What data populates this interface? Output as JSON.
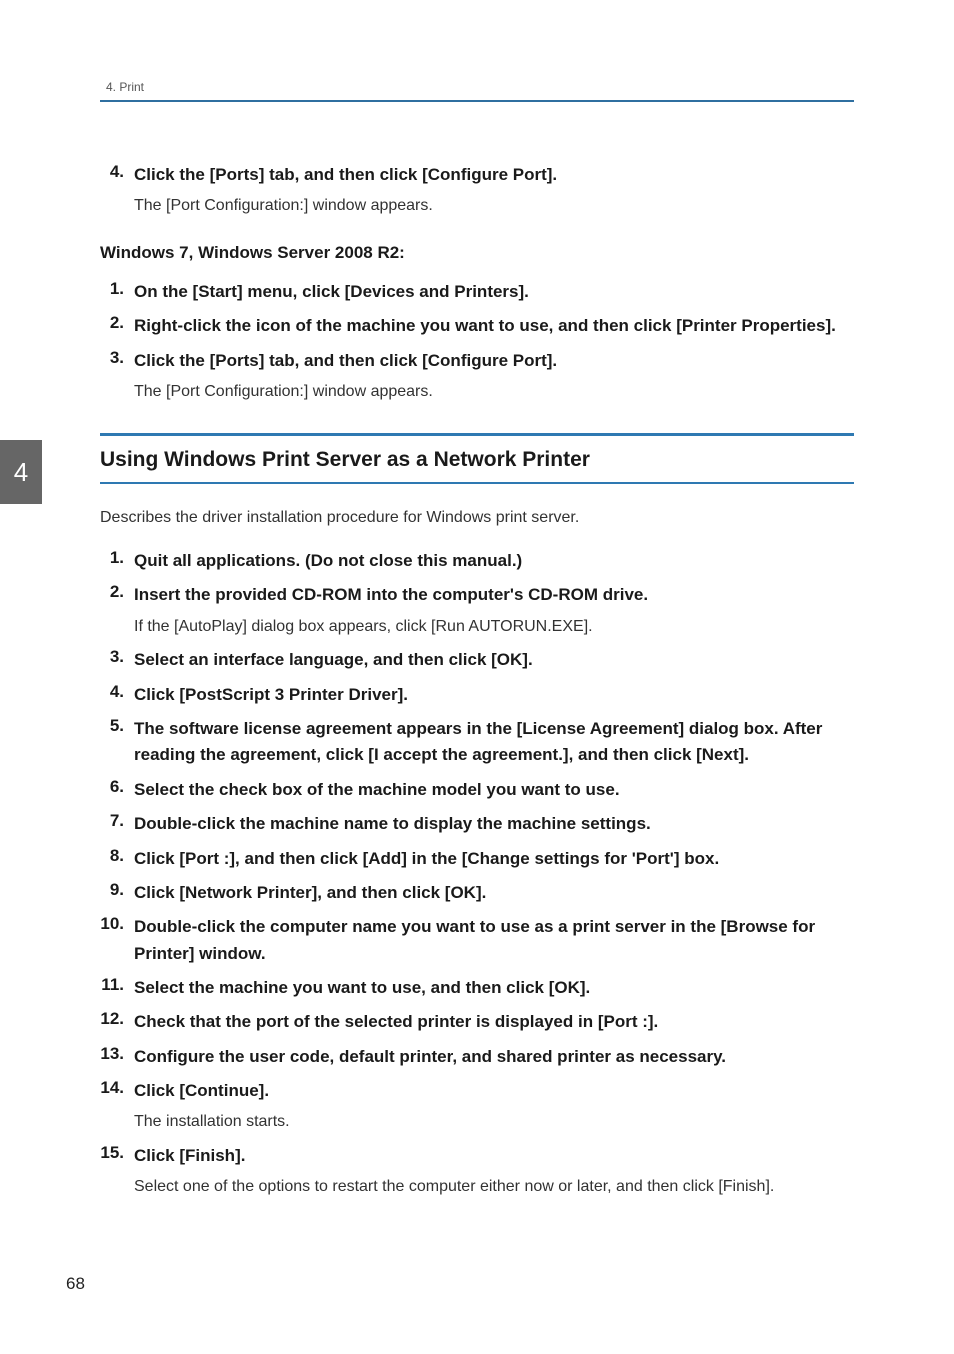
{
  "header": {
    "running_head": "4. Print"
  },
  "side_tab": "4",
  "block_a": {
    "steps": [
      {
        "num": "4.",
        "title": "Click the [Ports] tab, and then click [Configure Port].",
        "desc": "The [Port Configuration:] window appears."
      }
    ]
  },
  "sub_heading": "Windows 7, Windows Server 2008 R2:",
  "block_b": {
    "steps": [
      {
        "num": "1.",
        "title": "On the [Start] menu, click [Devices and Printers]."
      },
      {
        "num": "2.",
        "title": "Right-click the icon of the machine you want to use, and then click [Printer Properties]."
      },
      {
        "num": "3.",
        "title": "Click the [Ports] tab, and then click [Configure Port].",
        "desc": "The [Port Configuration:] window appears."
      }
    ]
  },
  "section": {
    "title": "Using Windows Print Server as a Network Printer",
    "intro": "Describes the driver installation procedure for Windows print server.",
    "steps": [
      {
        "num": "1.",
        "title": "Quit all applications. (Do not close this manual.)"
      },
      {
        "num": "2.",
        "title": "Insert the provided CD-ROM into the computer's CD-ROM drive.",
        "desc": "If the [AutoPlay] dialog box appears, click [Run AUTORUN.EXE]."
      },
      {
        "num": "3.",
        "title": "Select an interface language, and then click [OK]."
      },
      {
        "num": "4.",
        "title": "Click [PostScript 3 Printer Driver]."
      },
      {
        "num": "5.",
        "title": "The software license agreement appears in the [License Agreement] dialog box. After reading the agreement, click [I accept the agreement.], and then click [Next]."
      },
      {
        "num": "6.",
        "title": "Select the check box of the machine model you want to use."
      },
      {
        "num": "7.",
        "title": "Double-click the machine name to display the machine settings."
      },
      {
        "num": "8.",
        "title": "Click [Port :], and then click [Add] in the [Change settings for 'Port'] box."
      },
      {
        "num": "9.",
        "title": "Click [Network Printer], and then click [OK]."
      },
      {
        "num": "10.",
        "title": "Double-click the computer name you want to use as a print server in the [Browse for Printer] window."
      },
      {
        "num": "11.",
        "title": "Select the machine you want to use, and then click [OK]."
      },
      {
        "num": "12.",
        "title": "Check that the port of the selected printer is displayed in [Port :]."
      },
      {
        "num": "13.",
        "title": "Configure the user code, default printer, and shared printer as necessary."
      },
      {
        "num": "14.",
        "title": "Click [Continue].",
        "desc": "The installation starts."
      },
      {
        "num": "15.",
        "title": "Click [Finish].",
        "desc": "Select one of the options to restart the computer either now or later, and then click [Finish]."
      }
    ]
  },
  "page_number": "68"
}
